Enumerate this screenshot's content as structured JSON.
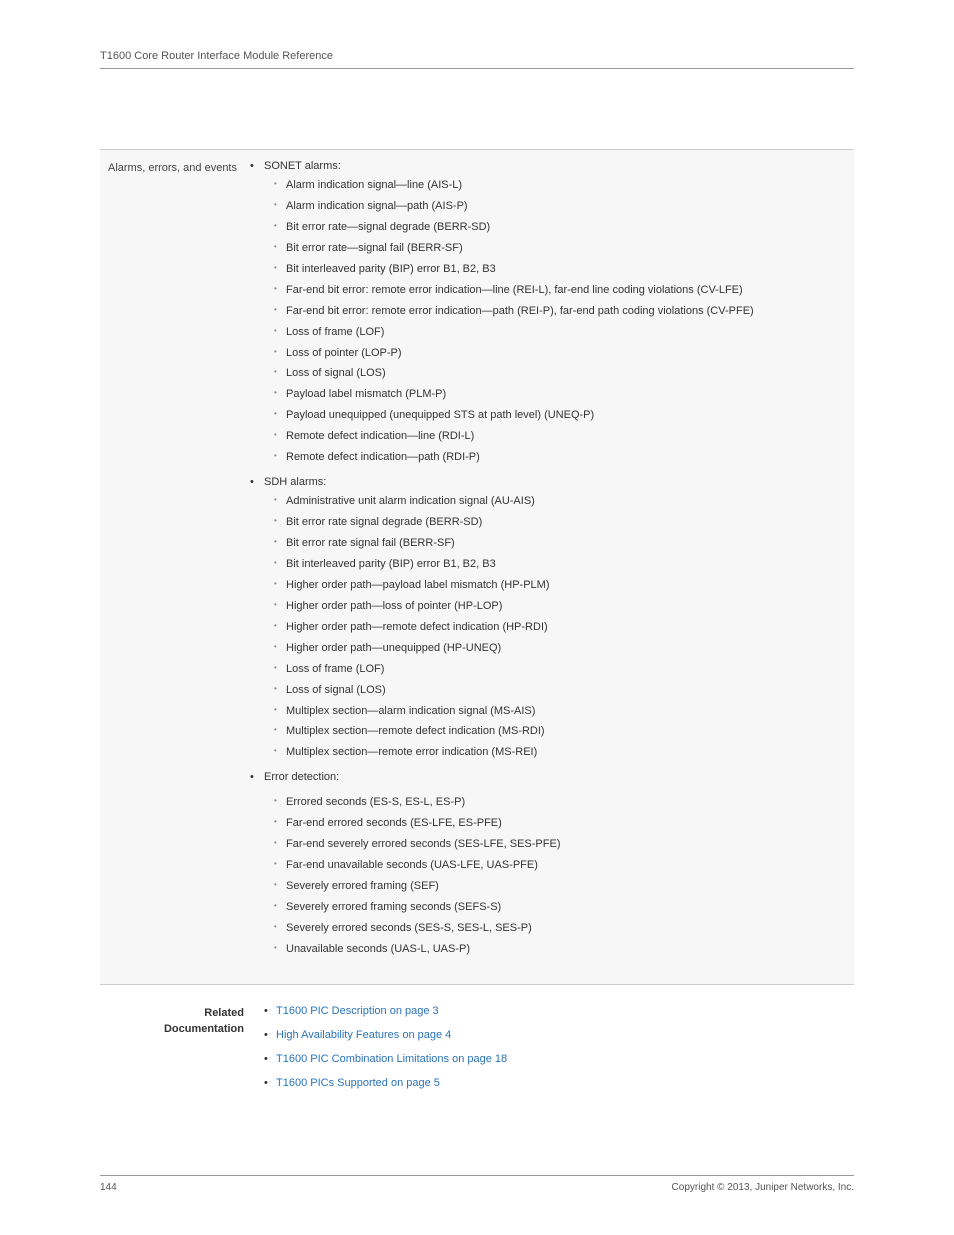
{
  "header": {
    "title": "T1600 Core Router Interface Module Reference"
  },
  "spec": {
    "label": "Alarms, errors, and events",
    "groups": [
      {
        "title": "SONET alarms:",
        "items": [
          "Alarm indication signal—line (AIS-L)",
          "Alarm indication signal—path (AIS-P)",
          "Bit error rate—signal degrade (BERR-SD)",
          "Bit error rate—signal fail (BERR-SF)",
          "Bit interleaved parity (BIP) error B1, B2, B3",
          "Far-end bit error: remote error indication—line (REI-L), far-end line coding violations (CV-LFE)",
          "Far-end bit error: remote error indication—path (REI-P), far-end path coding violations (CV-PFE)",
          "Loss of frame (LOF)",
          "Loss of pointer (LOP-P)",
          "Loss of signal (LOS)",
          "Payload label mismatch (PLM-P)",
          "Payload unequipped (unequipped STS at path level) (UNEQ-P)",
          "Remote defect indication—line (RDI-L)",
          "Remote defect indication—path (RDI-P)"
        ]
      },
      {
        "title": "SDH alarms:",
        "items": [
          "Administrative unit alarm indication signal (AU-AIS)",
          "Bit error rate signal degrade (BERR-SD)",
          "Bit error rate signal fail (BERR-SF)",
          "Bit interleaved parity (BIP) error B1, B2, B3",
          "Higher order path—payload label mismatch (HP-PLM)",
          "Higher order path—loss of pointer (HP-LOP)",
          "Higher order path—remote defect indication (HP-RDI)",
          "Higher order path—unequipped (HP-UNEQ)",
          "Loss of frame (LOF)",
          "Loss of signal (LOS)",
          "Multiplex section—alarm indication signal (MS-AIS)",
          "Multiplex section—remote defect indication (MS-RDI)",
          "Multiplex section—remote error indication (MS-REI)"
        ]
      },
      {
        "title": "Error detection:",
        "items": [
          "Errored seconds (ES-S, ES-L, ES-P)",
          "Far-end errored seconds (ES-LFE, ES-PFE)",
          "Far-end severely errored seconds (SES-LFE, SES-PFE)",
          "Far-end unavailable seconds (UAS-LFE, UAS-PFE)",
          "Severely errored framing (SEF)",
          "Severely errored framing seconds (SEFS-S)",
          "Severely errored seconds (SES-S, SES-L, SES-P)",
          "Unavailable seconds (UAS-L, UAS-P)"
        ]
      }
    ]
  },
  "related": {
    "label_line1": "Related",
    "label_line2": "Documentation",
    "links": [
      "T1600 PIC Description on page 3",
      "High Availability Features on page 4",
      "T1600 PIC Combination Limitations on page 18",
      "T1600 PICs Supported on page 5"
    ]
  },
  "footer": {
    "page": "144",
    "copyright": "Copyright © 2013, Juniper Networks, Inc."
  }
}
